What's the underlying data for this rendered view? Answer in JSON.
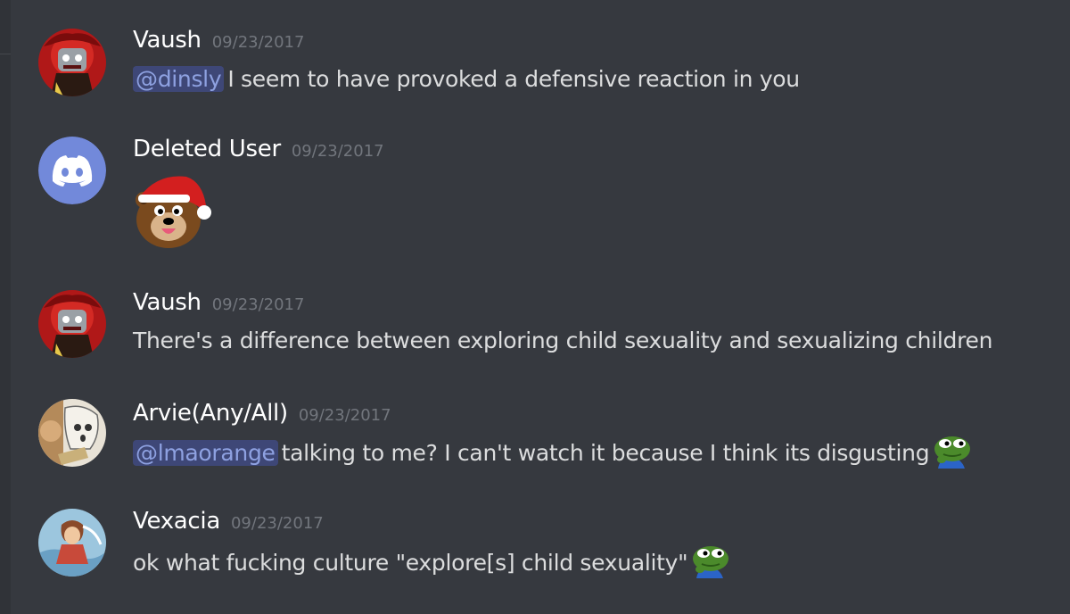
{
  "messages": [
    {
      "username": "Vaush",
      "timestamp": "09/23/2017",
      "mention": "@dinsly",
      "text": "I seem to have provoked a defensive reaction in you"
    },
    {
      "username": "Deleted User",
      "timestamp": "09/23/2017",
      "emoji": "pedobear-santa-emoji"
    },
    {
      "username": "Vaush",
      "timestamp": "09/23/2017",
      "text": "There's a difference between exploring child sexuality and sexualizing children"
    },
    {
      "username": "Arvie(Any/All)",
      "timestamp": "09/23/2017",
      "mention": "@lmaorange",
      "text": "talking to me? I can't watch it because I think its disgusting",
      "emoji": "pepe-think-emoji"
    },
    {
      "username": "Vexacia",
      "timestamp": "09/23/2017",
      "text": "ok what fucking culture \"explore[s] child sexuality\"",
      "emoji": "pepe-think-emoji"
    }
  ],
  "colors": {
    "background": "#36393f",
    "username": "#ffffff",
    "timestamp": "#72767d",
    "text": "#dcddde",
    "mention_bg": "#3e4777",
    "mention_text": "#8ea1e1",
    "discord_blurple": "#7289da"
  }
}
